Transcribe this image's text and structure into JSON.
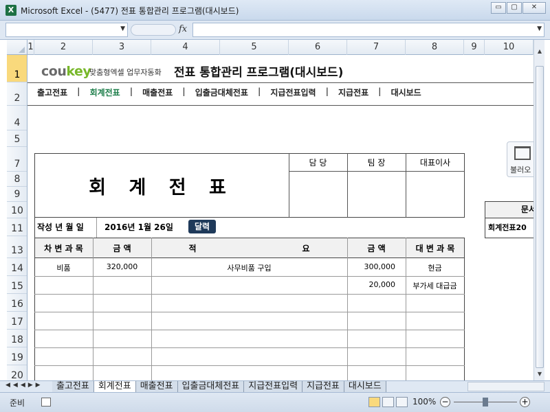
{
  "window": {
    "title": "Microsoft Excel - (5477) 전표 통합관리 프로그램(대시보드)",
    "app_icon": "excel-icon",
    "buttons": {
      "minimize": "▭",
      "restore": "▢",
      "close": "✕"
    }
  },
  "formula_bar": {
    "fx_label": "fx",
    "name_box": "",
    "formula": ""
  },
  "columns": [
    "1",
    "2",
    "3",
    "4",
    "5",
    "6",
    "7",
    "8",
    "9",
    "10"
  ],
  "rows": [
    "1",
    "2",
    "4",
    "5",
    "7",
    "8",
    "9",
    "10",
    "11",
    "13",
    "14",
    "15",
    "16",
    "17",
    "18",
    "19",
    "20"
  ],
  "header": {
    "brand_cou": "cou",
    "brand_key": "key",
    "brand_sub": "맞춤형엑셀 업무자동화",
    "program_title": "전표 통합관리 프로그램(대시보드)"
  },
  "nav": {
    "items": [
      "출고전표",
      "회계전표",
      "매출전표",
      "입출금대체전표",
      "지급전표입력",
      "지급전표",
      "대시보드"
    ],
    "separator": "|"
  },
  "voucher": {
    "title": "회 계 전 표",
    "approval": [
      "담  당",
      "팀  장",
      "대표이사"
    ],
    "date_label": "작성 년 월 일",
    "date_value": "2016년 1월 26일",
    "calendar_button": "달력",
    "columns": {
      "debit_account": "차 변 과 목",
      "amount": "금    액",
      "summary_left": "적",
      "summary_right": "요",
      "amount2": "금    액",
      "credit_account": "대 변 과 목"
    },
    "lines": [
      {
        "debit_account": "비품",
        "debit_amount": "320,000",
        "summary": "사무비품 구입",
        "credit_amount": "300,000",
        "credit_account": "현금"
      },
      {
        "debit_account": "",
        "debit_amount": "",
        "summary": "",
        "credit_amount": "20,000",
        "credit_account": "부가세 대급금"
      }
    ]
  },
  "side": {
    "load_button": "불러오",
    "doc_header": "문서",
    "doc_value": "회계전표20"
  },
  "sheet_tabs": [
    "출고전표",
    "회계전표",
    "매출전표",
    "입출금대체전표",
    "지급전표입력",
    "지급전표",
    "대시보드"
  ],
  "active_tab": "회계전표",
  "status": {
    "ready": "준비",
    "zoom": "100%"
  }
}
